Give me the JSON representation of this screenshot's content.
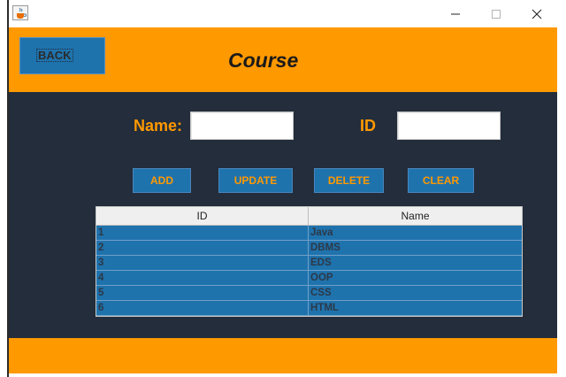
{
  "window": {
    "icon": "java-coffee-icon",
    "controls": {
      "minimize": "—",
      "maximize": "☐",
      "close": "✕"
    }
  },
  "header": {
    "back_label": "BACK",
    "title": "Course"
  },
  "form": {
    "name_label": "Name:",
    "id_label": "ID",
    "name_value": "",
    "id_value": ""
  },
  "actions": {
    "add": "ADD",
    "update": "UPDATE",
    "delete": "DELETE",
    "clear": "CLEAR"
  },
  "table": {
    "columns": [
      "ID",
      "Name"
    ],
    "rows": [
      [
        "1",
        "Java"
      ],
      [
        "2",
        "DBMS"
      ],
      [
        "3",
        "EDS"
      ],
      [
        "4",
        "OOP"
      ],
      [
        "5",
        "CSS"
      ],
      [
        "6",
        "HTML"
      ]
    ]
  },
  "colors": {
    "accent_orange": "#ff9900",
    "panel_dark": "#232d3b",
    "button_blue": "#1f73ad"
  }
}
